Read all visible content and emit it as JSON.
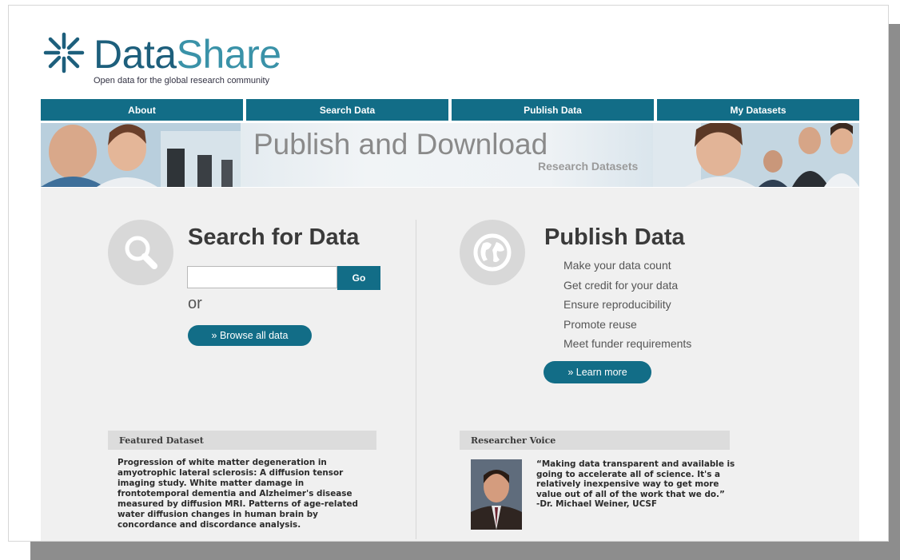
{
  "logo": {
    "word_part1": "Data",
    "word_part2": "Share",
    "tagline": "Open data for the global research community",
    "icon": "asterisk-burst-icon"
  },
  "nav": {
    "items": [
      {
        "label": "About"
      },
      {
        "label": "Search Data"
      },
      {
        "label": "Publish Data"
      },
      {
        "label": "My Datasets"
      }
    ]
  },
  "banner": {
    "title": "Publish and Download",
    "subtitle": "Research Datasets"
  },
  "search": {
    "title": "Search for Data",
    "input_value": "",
    "go_label": "Go",
    "or_label": "or",
    "browse_label": "» Browse all data",
    "icon": "magnifier-icon"
  },
  "publish": {
    "title": "Publish Data",
    "icon": "globe-icon",
    "benefits": [
      "Make your data count",
      "Get credit for your data",
      "Ensure reproducibility",
      "Promote reuse",
      "Meet funder requirements"
    ],
    "learn_more_label": "» Learn more"
  },
  "featured": {
    "heading": "Featured Dataset",
    "text": "Progression of white matter degeneration in amyotrophic lateral sclerosis: A diffusion tensor imaging study. White matter damage in frontotemporal dementia and Alzheimer's disease measured by diffusion MRI. Patterns of age-related water diffusion changes in human brain by concordance and discordance analysis."
  },
  "voice": {
    "heading": "Researcher Voice",
    "quote": "“Making data transparent and available is going to accelerate all of science. It's a relatively inexpensive way to get more value out of all of the work that we do.”",
    "attribution": "-Dr. Michael Weiner, UCSF"
  },
  "colors": {
    "accent": "#126d87",
    "logo_dark": "#1d5f7c",
    "logo_light": "#3a92a8",
    "content_bg": "#f0f0f0"
  }
}
